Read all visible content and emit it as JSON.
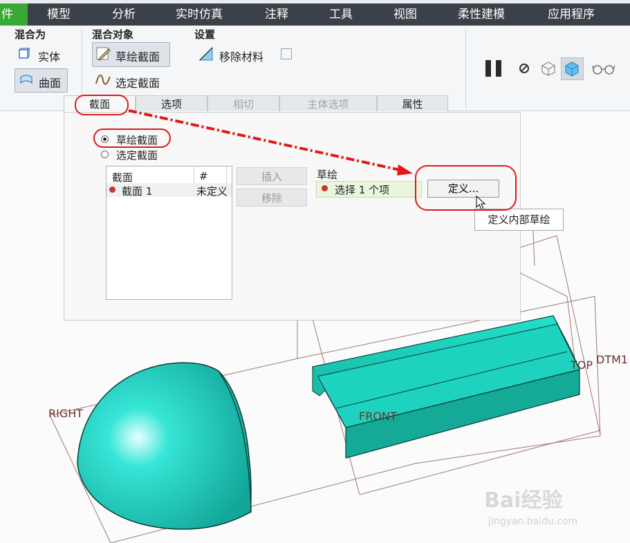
{
  "menu": {
    "file_partial": "件",
    "items": [
      "模型",
      "分析",
      "实时仿真",
      "注释",
      "工具",
      "视图",
      "柔性建模",
      "应用程序"
    ]
  },
  "ribbon": {
    "blend_as": {
      "title": "混合为",
      "solid": "实体",
      "surface": "曲面"
    },
    "blend_object": {
      "title": "混合对象",
      "sketch_section": "草绘截面",
      "selected_section": "选定截面"
    },
    "settings": {
      "title": "设置",
      "remove_material": "移除材料"
    }
  },
  "tabs": [
    "截面",
    "选项",
    "相切",
    "主体选项",
    "属性"
  ],
  "panel": {
    "radio_sketch": "草绘截面",
    "radio_selected": "选定截面",
    "list": {
      "col_section": "截面",
      "col_num": "#",
      "row_section": "截面 1",
      "row_status": "未定义"
    },
    "insert": "插入",
    "remove": "移除",
    "sketch_label": "草绘",
    "select_text": "选择 1 个项",
    "define": "定义...",
    "tooltip": "定义内部草绘"
  },
  "viewport": {
    "labels": {
      "right": "RIGHT",
      "front": "FRONT",
      "top": "TOP",
      "dtm": "DTM1"
    },
    "watermark": {
      "brand": "Bai经验",
      "url": "jingyan.baidu.com"
    }
  },
  "colors": {
    "menubar": "#3a4148",
    "file_tab": "#39a935",
    "solid": "#20d8c4",
    "annotation": "#e01818"
  }
}
